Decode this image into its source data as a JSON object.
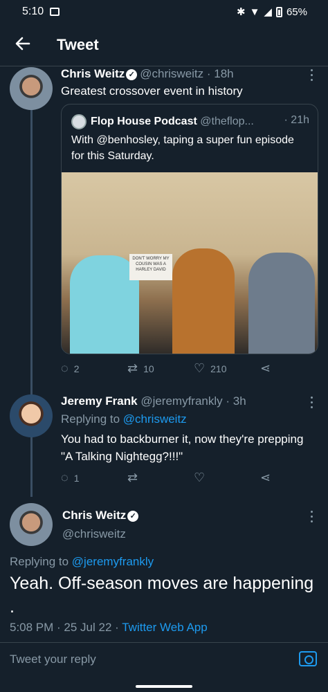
{
  "status_bar": {
    "time": "5:10",
    "battery": "65%"
  },
  "header": {
    "title": "Tweet"
  },
  "tweet1": {
    "name": "Chris Weitz",
    "handle": "@chrisweitz",
    "time": "· 18h",
    "text": "Greatest crossover event in history",
    "quote": {
      "name": "Flop House Podcast",
      "handle": "@theflop...",
      "time": "· 21h",
      "text": "With @benhosley, taping a super fun episode for this Saturday.",
      "photo_sign": "DON'T WORRY MY COUSIN WAS A HARLEY DAVID"
    },
    "replies": "2",
    "retweets": "10",
    "likes": "210"
  },
  "tweet2": {
    "name": "Jeremy Frank",
    "handle": "@jeremyfrankly",
    "time": "· 3h",
    "replying_prefix": "Replying to",
    "replying_to": "@chrisweitz",
    "text": "You had to backburner it, now they're prepping \"A Talking Nightegg?!!!\"",
    "replies": "1"
  },
  "main": {
    "name": "Chris Weitz",
    "handle": "@chrisweitz",
    "replying_prefix": "Replying to",
    "replying_to": "@jeremyfrankly",
    "text": "Yeah. Off-season moves are happening .",
    "timestamp": "5:08 PM · 25 Jul 22 ·",
    "source": "Twitter Web App"
  },
  "composer": {
    "placeholder": "Tweet your reply"
  },
  "colors": {
    "background": "#15202b",
    "accent": "#1d9bf0",
    "muted": "#8899a6"
  }
}
